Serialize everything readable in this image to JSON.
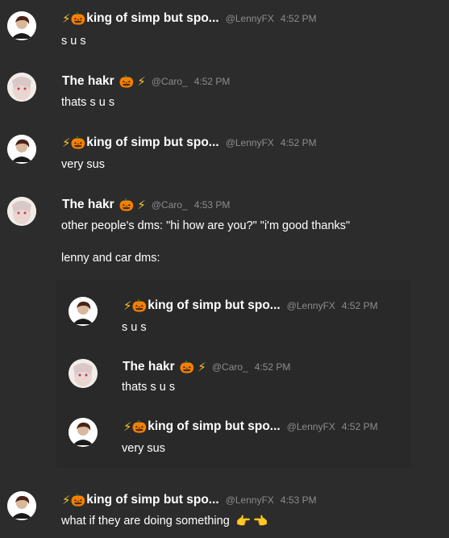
{
  "users": {
    "lenny": {
      "name": "king of simp but spo...",
      "handle": "@LennyFX"
    },
    "caro": {
      "name": "The hakr",
      "handle": "@Caro_"
    }
  },
  "emoji": {
    "bolt": "⚡",
    "pumpkin": "🎃",
    "point_right": "👉",
    "point_left": "👈"
  },
  "messages": {
    "m1": {
      "time": "4:52 PM",
      "text": "s u s"
    },
    "m2": {
      "time": "4:52 PM",
      "text": "thats s u s"
    },
    "m3": {
      "time": "4:52 PM",
      "text": "very sus"
    },
    "m4": {
      "time": "4:53 PM",
      "text1": "other people's dms: \"hi how are you?\" \"i'm good thanks\"",
      "text2": "lenny and car dms:"
    },
    "m5": {
      "time": "4:53 PM",
      "text": "what if they are doing something"
    }
  },
  "embed": {
    "e1": {
      "time": "4:52 PM",
      "text": "s u s"
    },
    "e2": {
      "time": "4:52 PM",
      "text": "thats s u s"
    },
    "e3": {
      "time": "4:52 PM",
      "text": "very sus"
    }
  },
  "colors": {
    "background": "#2c2c2c",
    "text": "#ffffff",
    "meta": "#8c8c8c"
  }
}
